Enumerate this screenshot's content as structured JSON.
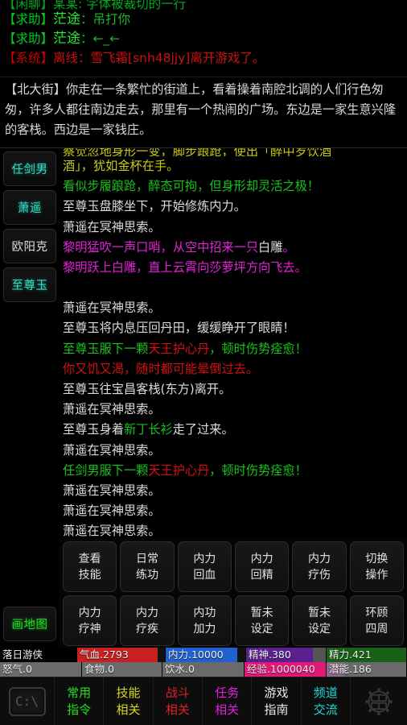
{
  "chat": {
    "clipped_line": "【闲聊】某某: 字体被裁切的一行",
    "lines": [
      {
        "tag": "【求助】",
        "name": "茫途",
        "sep": "：",
        "msg": "吊打你",
        "style": "green"
      },
      {
        "tag": "【求助】",
        "name": "茫途",
        "sep": "：",
        "msg": "←_←",
        "style": "green"
      },
      {
        "tag": "【系统】",
        "name": "离线：",
        "sep": "",
        "msg": "雪飞霜[snh48jjy]离开游戏了。",
        "style": "red"
      }
    ]
  },
  "room": {
    "text": "【北大街】你走在一条繁忙的街道上，看着操着南腔北调的人们行色匆匆，许多人都往南边走去，那里有一个热闹的广场。东边是一家生意兴隆的客栈。西边是一家钱庄。"
  },
  "left_rail": {
    "items": [
      {
        "label": "任剑男",
        "style": "cyan"
      },
      {
        "label": "萧遥",
        "style": "cyan"
      },
      {
        "label": "欧阳克",
        "style": "white"
      },
      {
        "label": "至尊玉",
        "style": "cyan"
      }
    ],
    "map_button": {
      "label": "画地图",
      "style": "green"
    }
  },
  "game_text": {
    "lines": [
      {
        "clip": true,
        "segments": [
          {
            "t": "察觉忽地身形一变，脚步踉跄，使出「醉中岁饮酒",
            "c": "yellow"
          }
        ]
      },
      {
        "segments": [
          {
            "t": "酒」，犹如金杯在手。",
            "c": "yellow"
          }
        ]
      },
      {
        "segments": [
          {
            "t": "看似步履踉跄，醉态可拘，但身形却灵活之极！",
            "c": "green"
          }
        ]
      },
      {
        "segments": [
          {
            "t": "至尊玉盘膝坐下，开始修炼内力。",
            "c": "white"
          }
        ]
      },
      {
        "segments": [
          {
            "t": "萧遥在冥神思索。",
            "c": "white"
          }
        ]
      },
      {
        "segments": [
          {
            "t": "黎明猛吹一声口哨，从空中招来一只",
            "c": "magenta"
          },
          {
            "t": "白雕",
            "c": "white"
          },
          {
            "t": "。",
            "c": "magenta"
          }
        ]
      },
      {
        "segments": [
          {
            "t": "黎明跃上白雕，直上云霄向莎萝坪方向飞去。",
            "c": "magenta"
          }
        ]
      },
      {
        "blank": true
      },
      {
        "segments": [
          {
            "t": "萧遥在冥神思索。",
            "c": "white"
          }
        ]
      },
      {
        "segments": [
          {
            "t": "至尊玉将内息压回丹田，缓缓睁开了眼睛！",
            "c": "white"
          }
        ]
      },
      {
        "segments": [
          {
            "t": "至尊玉服下一颗",
            "c": "green"
          },
          {
            "t": "天王护心丹",
            "c": "red"
          },
          {
            "t": "，顿时伤势痊愈！",
            "c": "green"
          }
        ]
      },
      {
        "segments": [
          {
            "t": "你又饥又渴，随时都可能晕倒过去。",
            "c": "red"
          }
        ]
      },
      {
        "segments": [
          {
            "t": "至尊玉往宝昌客栈(东方)离开。",
            "c": "white"
          }
        ]
      },
      {
        "segments": [
          {
            "t": "萧遥在冥神思索。",
            "c": "white"
          }
        ]
      },
      {
        "segments": [
          {
            "t": "至尊玉身着",
            "c": "white"
          },
          {
            "t": "新丁长衫",
            "c": "green"
          },
          {
            "t": "走了过来。",
            "c": "white"
          }
        ]
      },
      {
        "segments": [
          {
            "t": "萧遥在冥神思索。",
            "c": "white"
          }
        ]
      },
      {
        "segments": [
          {
            "t": "任剑男服下一颗",
            "c": "green"
          },
          {
            "t": "天王护心丹",
            "c": "red"
          },
          {
            "t": "，顿时伤势痊愈！",
            "c": "green"
          }
        ]
      },
      {
        "segments": [
          {
            "t": "萧遥在冥神思索。",
            "c": "white"
          }
        ]
      },
      {
        "segments": [
          {
            "t": "萧遥在冥神思索。",
            "c": "white"
          }
        ]
      },
      {
        "segments": [
          {
            "t": "萧遥在冥神思索。",
            "c": "white"
          }
        ]
      }
    ]
  },
  "commands": [
    {
      "l1": "查看",
      "l2": "技能"
    },
    {
      "l1": "日常",
      "l2": "练功"
    },
    {
      "l1": "内力",
      "l2": "回血"
    },
    {
      "l1": "内力",
      "l2": "回精"
    },
    {
      "l1": "内力",
      "l2": "疗伤"
    },
    {
      "l1": "切换",
      "l2": "操作"
    },
    {
      "l1": "内力",
      "l2": "疗神"
    },
    {
      "l1": "内力",
      "l2": "疗疾"
    },
    {
      "l1": "内功",
      "l2": "加力"
    },
    {
      "l1": "暂未",
      "l2": "设定"
    },
    {
      "l1": "暂未",
      "l2": "设定"
    },
    {
      "l1": "环顾",
      "l2": "四周"
    }
  ],
  "stats": {
    "row1": [
      {
        "label": "落日游侠",
        "color": "#000000",
        "track": "#000000",
        "pct": 100,
        "width": 96
      },
      {
        "label": "气血.2793",
        "color": "#c62020",
        "track": "#111111",
        "pct": 92,
        "width": 110
      },
      {
        "label": "内力.10000",
        "color": "#2060d0",
        "track": "#111111",
        "pct": 90,
        "width": 100
      },
      {
        "label": "精神.380",
        "color": "#5a2090",
        "track": "#555555",
        "pct": 84,
        "width": 100
      },
      {
        "label": "精力.421",
        "color": "#186018",
        "track": "#111111",
        "pct": 100,
        "width": 100
      }
    ],
    "row2": [
      {
        "label": "怒气.0",
        "color": "#6a6a6a",
        "track": "#6a6a6a",
        "pct": 100,
        "width": 102
      },
      {
        "label": "食物.0",
        "color": "#6a6a6a",
        "track": "#6a6a6a",
        "pct": 100,
        "width": 100
      },
      {
        "label": "饮水.0",
        "color": "#6a6a6a",
        "track": "#6a6a6a",
        "pct": 100,
        "width": 102
      },
      {
        "label": "经验.1000040",
        "color": "#e01878",
        "track": "#6a6a6a",
        "pct": 100,
        "width": 102
      },
      {
        "label": "潜能.186",
        "color": "#8a6a8a",
        "track": "#6a6a6a",
        "pct": 22,
        "width": 100
      }
    ]
  },
  "toolbar": {
    "console_icon": "console-icon",
    "console_text": "C:\\",
    "items": [
      {
        "l1": "常用",
        "l2": "指令",
        "style": "green"
      },
      {
        "l1": "技能",
        "l2": "相关",
        "style": "yellow"
      },
      {
        "l1": "战斗",
        "l2": "相关",
        "style": "red"
      },
      {
        "l1": "任务",
        "l2": "相关",
        "style": "magenta"
      },
      {
        "l1": "游戏",
        "l2": "指南",
        "style": "white"
      },
      {
        "l1": "频道",
        "l2": "交流",
        "style": "cyan"
      }
    ],
    "settings_icon": "gear-icon"
  }
}
